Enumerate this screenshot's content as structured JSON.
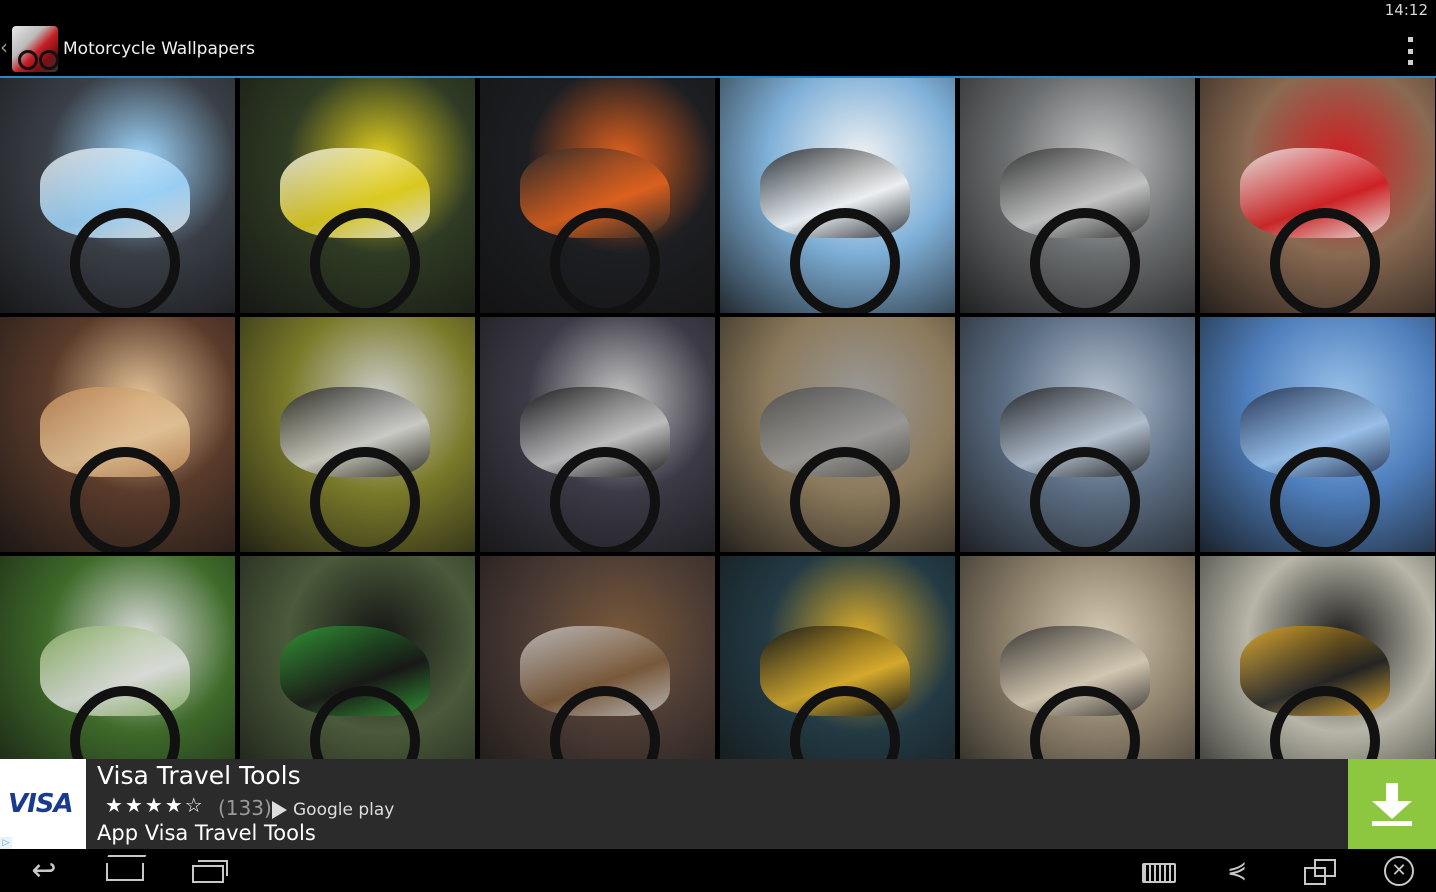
{
  "status_bar": {
    "time": "14:12"
  },
  "action_bar": {
    "title": "Motorcycle Wallpapers",
    "up_caret": "‹"
  },
  "wallpapers": [
    {
      "name": "white-sport-bike",
      "bg": "#3a3f47",
      "accent": "#e9e9e9",
      "highlight": "#9fd8ff"
    },
    {
      "name": "rider-yamaha-46",
      "bg": "#2f3b24",
      "accent": "#f2f2f2",
      "highlight": "#e6d21e"
    },
    {
      "name": "orange-ktm-supermoto",
      "bg": "#1d1e22",
      "accent": "#2a2a2a",
      "highlight": "#e8641e"
    },
    {
      "name": "bike-road-sky",
      "bg": "#7fb0d8",
      "accent": "#1d1d1d",
      "highlight": "#f4f4f4"
    },
    {
      "name": "deus-cafe-racer-garage",
      "bg": "#6b6e70",
      "accent": "#2b2b2b",
      "highlight": "#c9c9c9"
    },
    {
      "name": "red-white-ducati",
      "bg": "#8a6a52",
      "accent": "#f3f3f3",
      "highlight": "#d21c21"
    },
    {
      "name": "fantasy-rider-art",
      "bg": "#5a3b2b",
      "accent": "#c08a58",
      "highlight": "#e8c79a"
    },
    {
      "name": "black-cruiser-autumn",
      "bg": "#7a7a2a",
      "accent": "#1f1f1f",
      "highlight": "#cfcfcf"
    },
    {
      "name": "black-chopper",
      "bg": "#3c3a46",
      "accent": "#141414",
      "highlight": "#c7c7c7"
    },
    {
      "name": "gray-custom-bike-shop",
      "bg": "#8c7a5c",
      "accent": "#4a4a4a",
      "highlight": "#9a9a9a"
    },
    {
      "name": "rider-ducati-diavel",
      "bg": "#5d6f85",
      "accent": "#1a1a1a",
      "highlight": "#b8c4d2"
    },
    {
      "name": "blue-kawasaki-zzr",
      "bg": "#4f7fbd",
      "accent": "#1e2a46",
      "highlight": "#9cc3ea"
    },
    {
      "name": "bike-tree-avenue",
      "bg": "#3e6a2a",
      "accent": "#8fb46a",
      "highlight": "#e0e0e0"
    },
    {
      "name": "green-kawasaki-wheelie",
      "bg": "#4a5a3a",
      "accent": "#2e9a33",
      "highlight": "#141414"
    },
    {
      "name": "silver-bike-railcar",
      "bg": "#4a3a34",
      "accent": "#c9c9c9",
      "highlight": "#7a5a3a"
    },
    {
      "name": "speed-blur-night",
      "bg": "#233a44",
      "accent": "#121212",
      "highlight": "#e0b02a"
    },
    {
      "name": "cafe-racer-ruins",
      "bg": "#8c7f6a",
      "accent": "#2c2c2c",
      "highlight": "#d6cbb5"
    },
    {
      "name": "yellow-aprilia",
      "bg": "#b8b6a8",
      "accent": "#e0a51e",
      "highlight": "#1a1a1a"
    }
  ],
  "ad": {
    "brand": "VISA",
    "title": "Visa Travel Tools",
    "stars": "★★★★☆",
    "rating_count": "(133)",
    "store": "Google play",
    "subtitle": "App Visa Travel Tools",
    "cta_color": "#8dc63f"
  },
  "nav_bar": {
    "back_glyph": "↩",
    "share_glyph": "⋞",
    "close_glyph": "✕"
  }
}
